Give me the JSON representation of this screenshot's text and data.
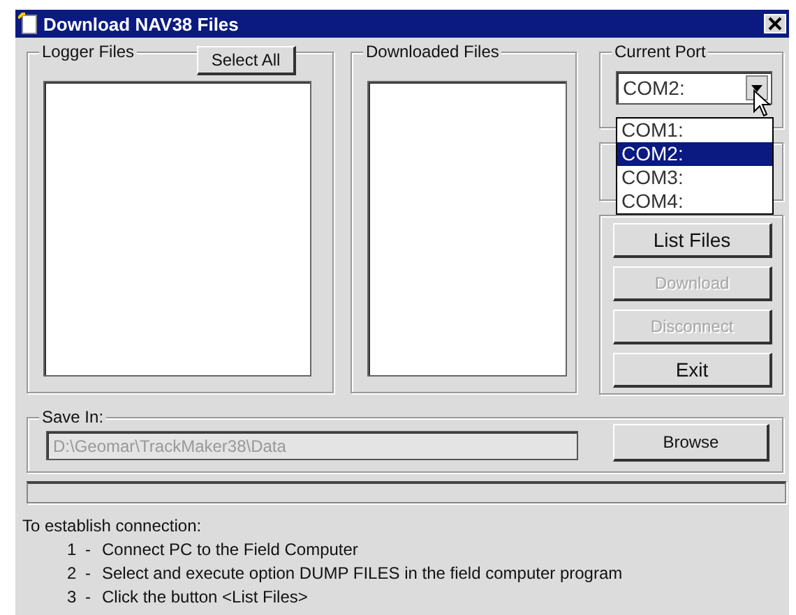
{
  "window": {
    "title": "Download NAV38 Files"
  },
  "logger_files": {
    "label": "Logger Files",
    "select_all_button": "Select All"
  },
  "downloaded_files": {
    "label": "Downloaded Files"
  },
  "current_port": {
    "label": "Current Port",
    "value": "COM2:",
    "dropdown_expanded": true,
    "options": [
      {
        "label": "COM1:",
        "selected": false
      },
      {
        "label": "COM2:",
        "selected": true
      },
      {
        "label": "COM3:",
        "selected": false
      },
      {
        "label": "COM4:",
        "selected": false
      }
    ]
  },
  "actions": [
    {
      "label": "List Files",
      "disabled": false
    },
    {
      "label": "Download",
      "disabled": true
    },
    {
      "label": "Disconnect",
      "disabled": true
    },
    {
      "label": "Exit",
      "disabled": false
    }
  ],
  "save_in": {
    "label": "Save In:",
    "value": "D:\\Geomar\\TrackMaker38\\Data",
    "disabled": true,
    "browse_button": "Browse"
  },
  "progress": {
    "level": 0
  },
  "instructions": {
    "heading": "To establish connection:",
    "steps": [
      {
        "number": "1",
        "dash": "-",
        "text": "Connect PC to the Field Computer"
      },
      {
        "number": "2",
        "dash": "-",
        "text": "Select and execute option DUMP FILES in the field computer program"
      },
      {
        "number": "3",
        "dash": "-",
        "text": "Click the button <List Files>"
      }
    ]
  }
}
